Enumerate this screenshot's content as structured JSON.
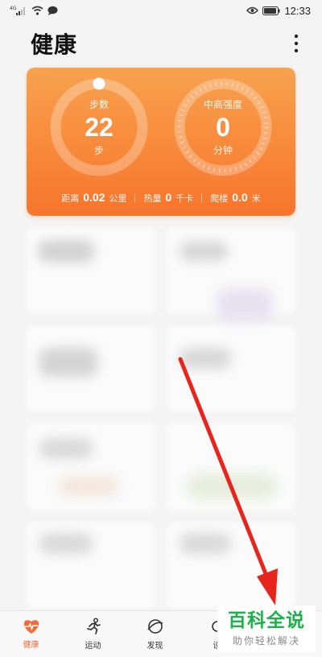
{
  "status_bar": {
    "network": "4G",
    "time": "12:33"
  },
  "header": {
    "title": "健康"
  },
  "summary": {
    "steps": {
      "label": "步数",
      "value": "22",
      "unit": "步",
      "progress": 0.0
    },
    "intensity": {
      "label": "中高强度",
      "value": "0",
      "unit": "分钟"
    },
    "distance": {
      "label": "距离",
      "value": "0.02",
      "unit": "公里"
    },
    "calories": {
      "label": "热量",
      "value": "0",
      "unit": "千卡"
    },
    "floors": {
      "label": "爬楼",
      "value": "0.0",
      "unit": "米"
    }
  },
  "nav": {
    "items": [
      {
        "label": "健康",
        "icon": "heart-pulse-icon",
        "active": true
      },
      {
        "label": "运动",
        "icon": "running-icon",
        "active": false
      },
      {
        "label": "发现",
        "icon": "planet-icon",
        "active": false
      },
      {
        "label": "设",
        "icon": "devices-icon",
        "active": false
      }
    ]
  },
  "watermark": {
    "main": "百科全说",
    "sub": "助你轻松解决"
  },
  "colors": {
    "card_orange": "#f8893a",
    "active_tab": "#f26b3a",
    "arrow_red": "#e8251d",
    "watermark_green": "#19b34a"
  }
}
